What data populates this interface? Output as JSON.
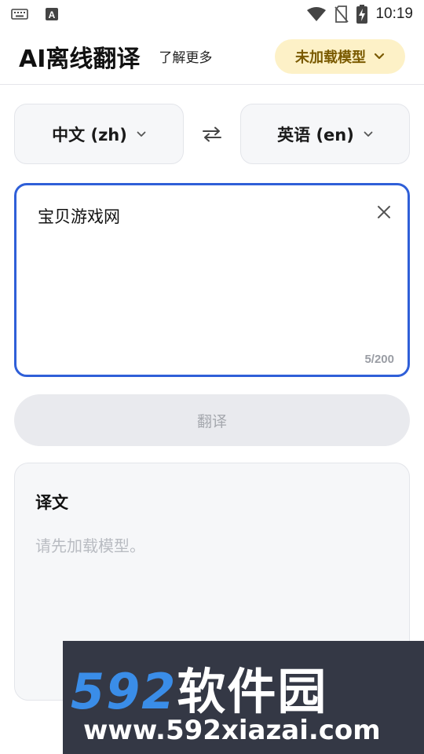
{
  "status_bar": {
    "time": "10:19",
    "icons": [
      "keyboard-icon",
      "a-notification-icon",
      "wifi-icon",
      "no-sim-icon",
      "battery-charging-icon"
    ]
  },
  "header": {
    "title": "AI离线翻译",
    "learn_more": "了解更多",
    "model_button": "未加载模型"
  },
  "languages": {
    "source": "中文 (zh)",
    "target": "英语 (en)"
  },
  "input": {
    "value": "宝贝游戏网",
    "char_count": "5/200"
  },
  "translate_button": "翻译",
  "result": {
    "title": "译文",
    "placeholder": "请先加载模型。"
  },
  "watermark": {
    "digits": "592",
    "name": "软件园",
    "url": "www.592xiazai.com"
  },
  "colors": {
    "accent": "#2f5fd8",
    "model_button_bg": "#fdf1c7",
    "model_button_text": "#7a5a00"
  }
}
